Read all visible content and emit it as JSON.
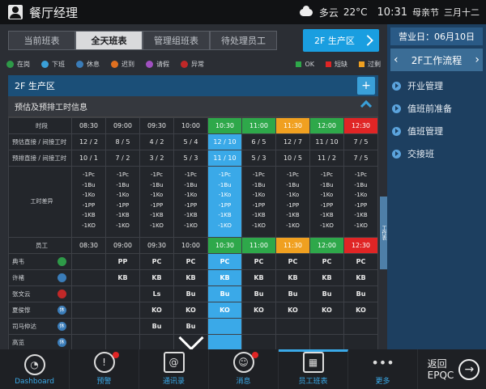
{
  "topbar": {
    "title": "餐厅经理",
    "weather": "多云",
    "temp": "22°C",
    "time": "10:31",
    "holiday": "母亲节",
    "lunar": "三月十二"
  },
  "tabs": [
    "当前班表",
    "全天班表",
    "管理组班表",
    "待处理员工"
  ],
  "zone_button": "2F  生产区",
  "legend": [
    {
      "label": "在岗",
      "color": "#3aa0d8"
    },
    {
      "label": "下班",
      "color": "#3aa0d8"
    },
    {
      "label": "休息",
      "color": "#3aa0d8"
    },
    {
      "label": "迟到",
      "color": "#e07020"
    },
    {
      "label": "请假",
      "color": "#a050c0"
    },
    {
      "label": "异常",
      "color": "#e02525"
    }
  ],
  "legend_status": [
    {
      "label": "OK",
      "color": "#2ea84a"
    },
    {
      "label": "短缺",
      "color": "#e02525"
    },
    {
      "label": "过剩",
      "color": "#f0a020"
    }
  ],
  "panel_title": "2F 生产区",
  "section_title": "预估及预排工时信息",
  "table": {
    "time_label": "时段",
    "times": [
      "08:30",
      "09:00",
      "09:30",
      "10:00",
      "10:30",
      "11:00",
      "11:30",
      "12:00",
      "12:30"
    ],
    "forecast_label": "预估直接 / 间接工时",
    "forecast": [
      "12 / 2",
      "8 / 5",
      "4 / 2",
      "5 / 4",
      "12 / 10",
      "6 / 5",
      "12 / 7",
      "11 / 10",
      "7 / 5"
    ],
    "scheduled_label": "预排直接 / 间接工时",
    "scheduled": [
      "10 / 1",
      "7 / 2",
      "3 / 2",
      "5 / 3",
      "11 / 10",
      "5 / 3",
      "10 / 5",
      "11 / 2",
      "7 / 5"
    ],
    "diff_label": "工时差异",
    "diff_lines": [
      "-1Pc",
      "-1Bu",
      "-1Ko",
      "-1PP",
      "-1KB",
      "-1KO"
    ],
    "employee_label": "员工",
    "employees": [
      {
        "name": "典韦",
        "badge": "",
        "cells": [
          "",
          "PP",
          "PC",
          "PC",
          "PC",
          "PC",
          "PC",
          "PC",
          "PC"
        ]
      },
      {
        "name": "许褚",
        "badge": "",
        "cells": [
          "",
          "KB",
          "KB",
          "KB",
          "KB",
          "KB",
          "KB",
          "KB",
          "KB"
        ]
      },
      {
        "name": "张文云",
        "badge": "",
        "cells": [
          "",
          "",
          "Ls",
          "Bu",
          "Bu",
          "Bu",
          "Bu",
          "Bu",
          "Bu"
        ]
      },
      {
        "name": "夏侯惇",
        "badge": "休",
        "cells": [
          "",
          "",
          "KO",
          "KO",
          "KO",
          "KO",
          "KO",
          "KO",
          "KO"
        ]
      },
      {
        "name": "司马仲达",
        "badge": "休",
        "cells": [
          "",
          "",
          "Bu",
          "Bu",
          "",
          "",
          "",
          "",
          ""
        ]
      },
      {
        "name": "高览",
        "badge": "休",
        "cells": [
          "",
          "",
          "",
          "",
          "",
          "",
          "",
          "",
          ""
        ]
      }
    ]
  },
  "side_tab": "工作表",
  "side": {
    "date": "营业日：06月10日",
    "flow": "2F工作流程",
    "items": [
      "开业管理",
      "值班前准备",
      "值班管理",
      "交接班"
    ]
  },
  "bottom": {
    "nav": [
      {
        "label": "Dashboard",
        "icon": "gauge-icon"
      },
      {
        "label": "预警",
        "icon": "alert-icon"
      },
      {
        "label": "通讯录",
        "icon": "contacts-icon"
      },
      {
        "label": "消息",
        "icon": "message-icon"
      },
      {
        "label": "员工班表",
        "icon": "calendar-icon"
      },
      {
        "label": "更多",
        "icon": "more-icon"
      }
    ],
    "back_label": "返回\nEPQC"
  }
}
